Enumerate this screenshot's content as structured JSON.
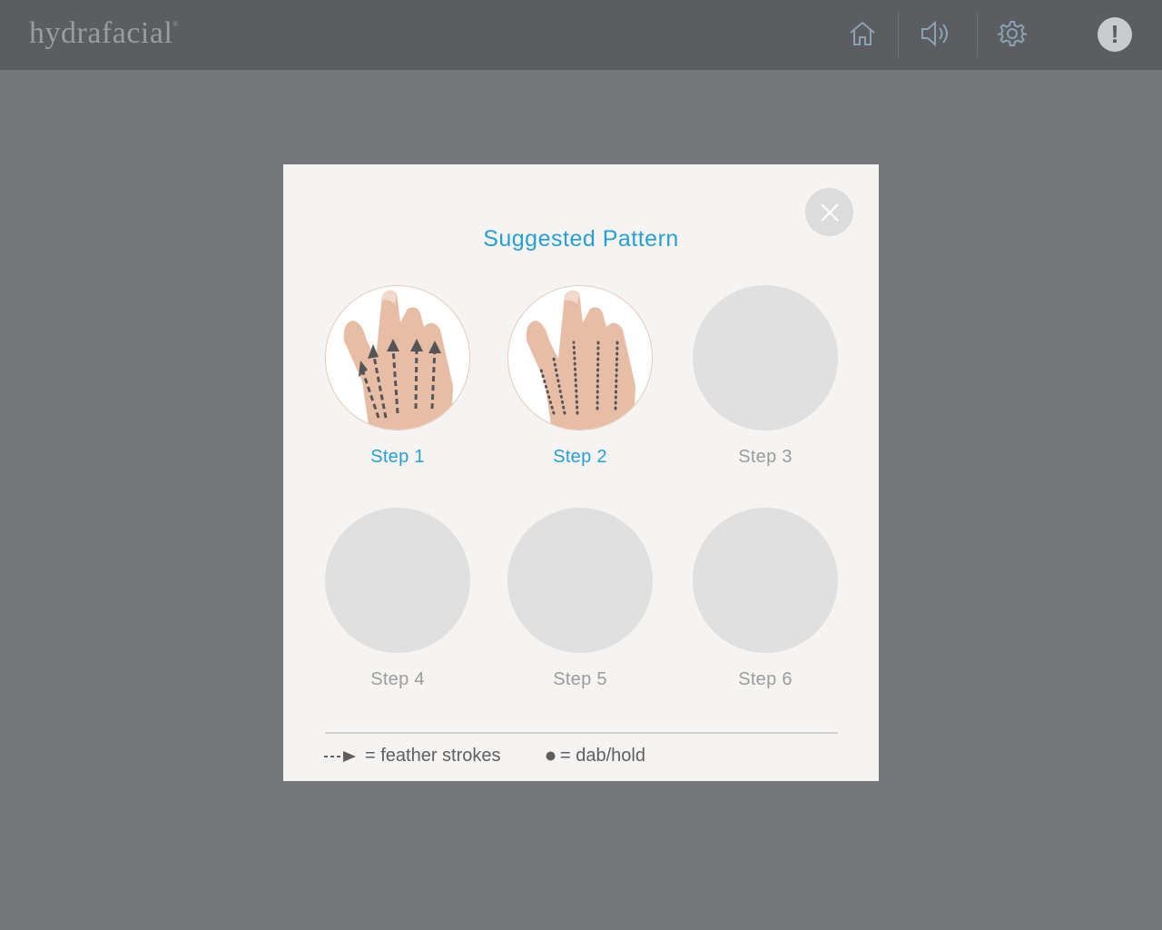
{
  "header": {
    "brand": "hydrafacial",
    "brand_mark": "®",
    "icons": [
      "home-icon",
      "speaker-icon",
      "gear-icon",
      "alert-icon"
    ],
    "alert_glyph": "!"
  },
  "modal": {
    "title": "Suggested Pattern",
    "steps": [
      {
        "label": "Step 1",
        "active": true
      },
      {
        "label": "Step 2",
        "active": true
      },
      {
        "label": "Step 3",
        "active": false
      },
      {
        "label": "Step 4",
        "active": false
      },
      {
        "label": "Step 5",
        "active": false
      },
      {
        "label": "Step 6",
        "active": false
      }
    ],
    "legend": {
      "feather": "= feather strokes",
      "dab": "= dab/hold"
    }
  },
  "colors": {
    "accent": "#27a0d3",
    "inactive_text": "#9c9c9c",
    "topbar": "#5c5d61",
    "backdrop": "#76777b",
    "modal_bg": "#f5f4f2"
  }
}
